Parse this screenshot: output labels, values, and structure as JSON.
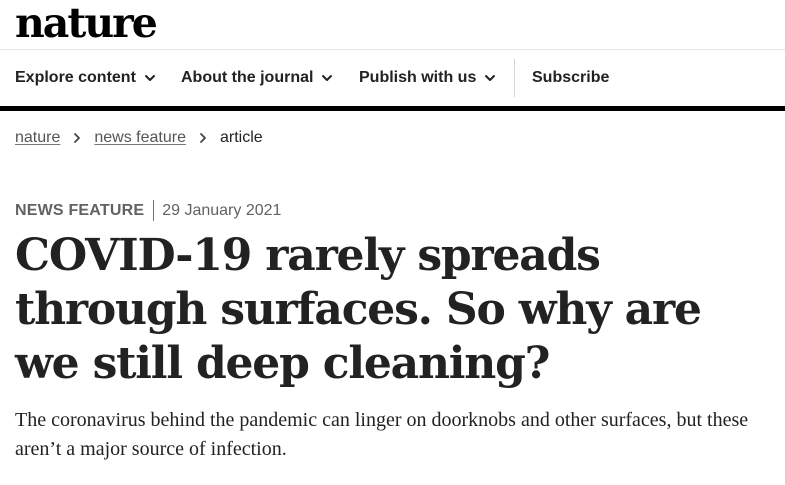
{
  "masthead": {
    "logo_text": "nature"
  },
  "nav": {
    "items": [
      {
        "label": "Explore content",
        "has_dropdown": true
      },
      {
        "label": "About the journal",
        "has_dropdown": true
      },
      {
        "label": "Publish with us",
        "has_dropdown": true
      },
      {
        "label": "Subscribe",
        "has_dropdown": false
      }
    ]
  },
  "breadcrumb": {
    "items": [
      {
        "label": "nature",
        "link": true
      },
      {
        "label": "news feature",
        "link": true
      },
      {
        "label": "article",
        "link": false
      }
    ]
  },
  "article": {
    "type": "NEWS FEATURE",
    "date": "29 January 2021",
    "title": "COVID-19 rarely spreads through surfaces. So why are we still deep cleaning?",
    "standfirst": "The coronavirus behind the pandemic can linger on doorknobs and other surfaces, but these aren’t a major source of infection."
  },
  "colors": {
    "text": "#222222",
    "muted": "#626262",
    "nav_rule": "#000000",
    "background": "#ffffff"
  },
  "icons": {
    "dropdown": "chevron-down-icon",
    "breadcrumb_separator": "chevron-right-icon"
  }
}
